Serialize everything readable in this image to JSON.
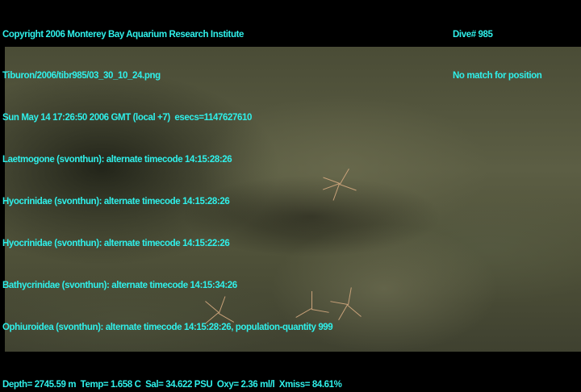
{
  "header": {
    "copyright": "Copyright 2006 Monterey Bay Aquarium Research Institute",
    "file": "Tiburon/2006/tibr985/03_30_10_24.png",
    "datetime": "Sun May 14 17:26:50 2006 GMT (local +7)  esecs=1147627610"
  },
  "annotations": [
    "Laetmogone (svonthun): alternate timecode 14:15:28:26",
    "Hyocrinidae (svonthun): alternate timecode 14:15:28:26",
    "Hyocrinidae (svonthun): alternate timecode 14:15:22:26",
    "Bathycrinidae (svonthun): alternate timecode 14:15:34:26",
    "Ophiuroidea (svonthun): alternate timecode 14:15:28:26, population-quantity 999"
  ],
  "dive": {
    "number": "Dive# 985",
    "position": "No match for position"
  },
  "sensors": "Depth= 2745.59 m  Temp= 1.658 C  Sal= 34.622 PSU  Oxy= 2.36 ml/l  Xmiss= 84.61%"
}
